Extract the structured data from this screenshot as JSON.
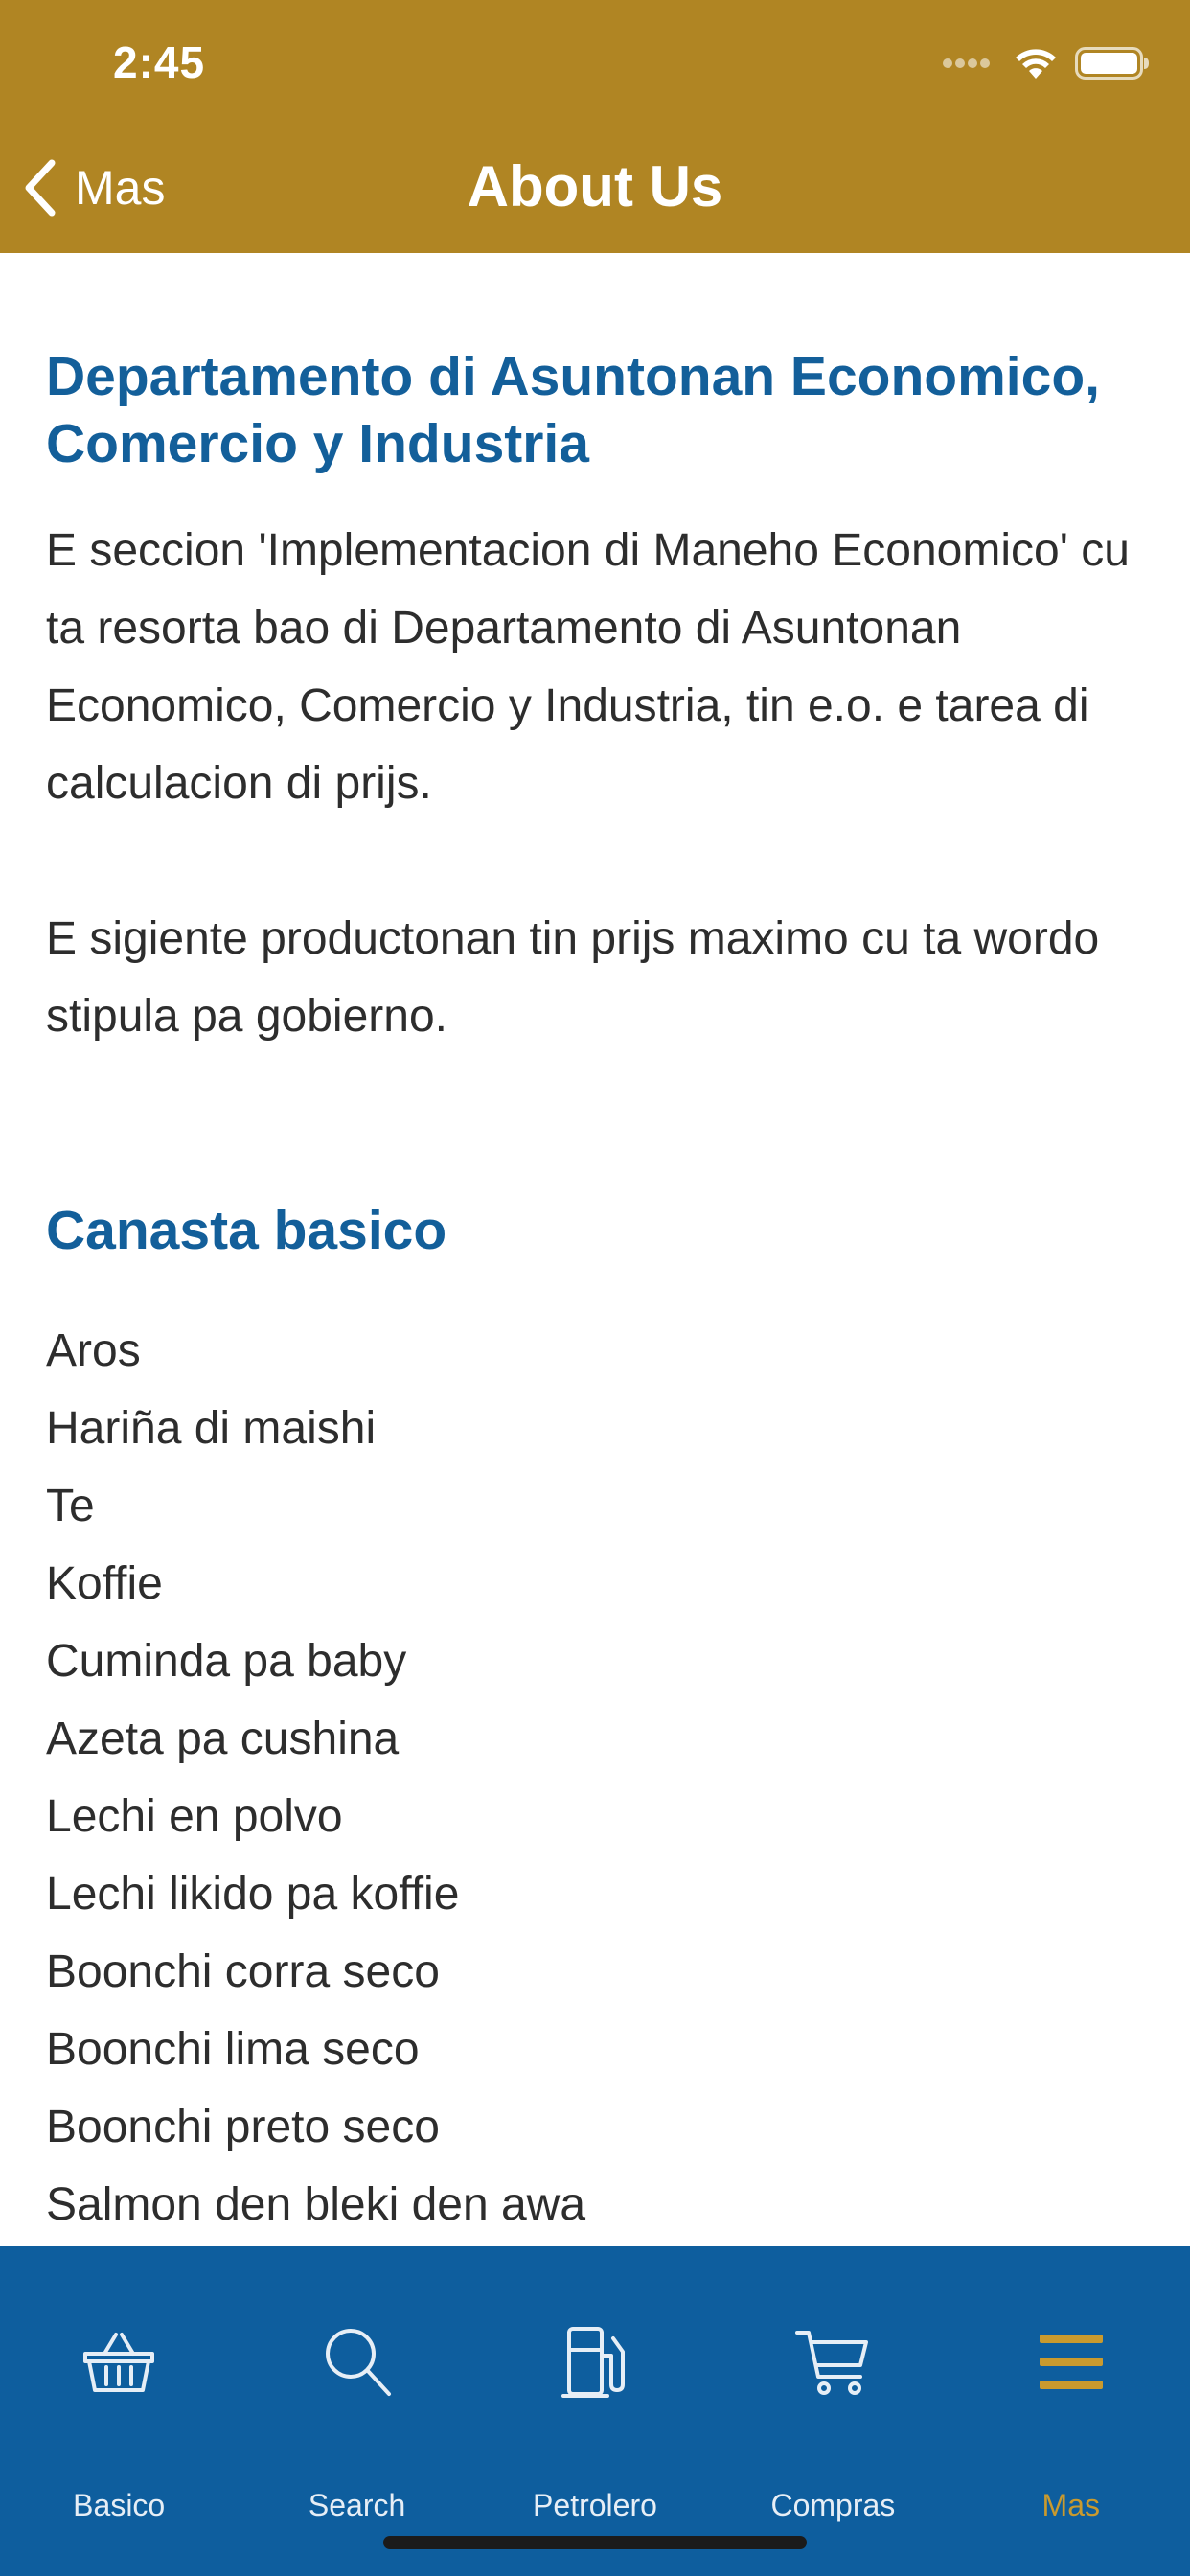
{
  "status_bar": {
    "time": "2:45"
  },
  "nav": {
    "back_label": "Mas",
    "title": "About Us"
  },
  "sections": {
    "department": {
      "heading": "Departamento di Asuntonan Economico, Comercio y Industria",
      "paragraph_1": "E seccion 'Implementacion di Maneho Economico' cu ta resorta bao di Departamento di Asuntonan Economico, Comercio y Industria, tin e.o. e tarea di calculacion di prijs.",
      "paragraph_2": "E sigiente productonan tin prijs maximo cu ta wordo stipula pa gobierno."
    },
    "canasta": {
      "heading": "Canasta basico",
      "items": [
        "Aros",
        "Hariña di maishi",
        "Te",
        "Koffie",
        "Cuminda pa baby",
        "Azeta pa cushina",
        "Lechi en polvo",
        "Lechi likido pa koffie",
        "Boonchi corra seco",
        "Boonchi lima seco",
        "Boonchi preto seco",
        "Salmon den bleki den awa"
      ]
    }
  },
  "tab_bar": {
    "tabs": [
      {
        "label": "Basico",
        "icon": "basket-icon",
        "active": false
      },
      {
        "label": "Search",
        "icon": "search-icon",
        "active": false
      },
      {
        "label": "Petrolero",
        "icon": "fuel-pump-icon",
        "active": false
      },
      {
        "label": "Compras",
        "icon": "cart-icon",
        "active": false
      },
      {
        "label": "Mas",
        "icon": "menu-icon",
        "active": true
      }
    ]
  },
  "colors": {
    "header_background": "#b08523",
    "heading_text": "#135f9a",
    "tab_bar_background": "#0e5e9e",
    "tab_active": "#c99a2e",
    "tab_inactive": "#e6eef6"
  }
}
